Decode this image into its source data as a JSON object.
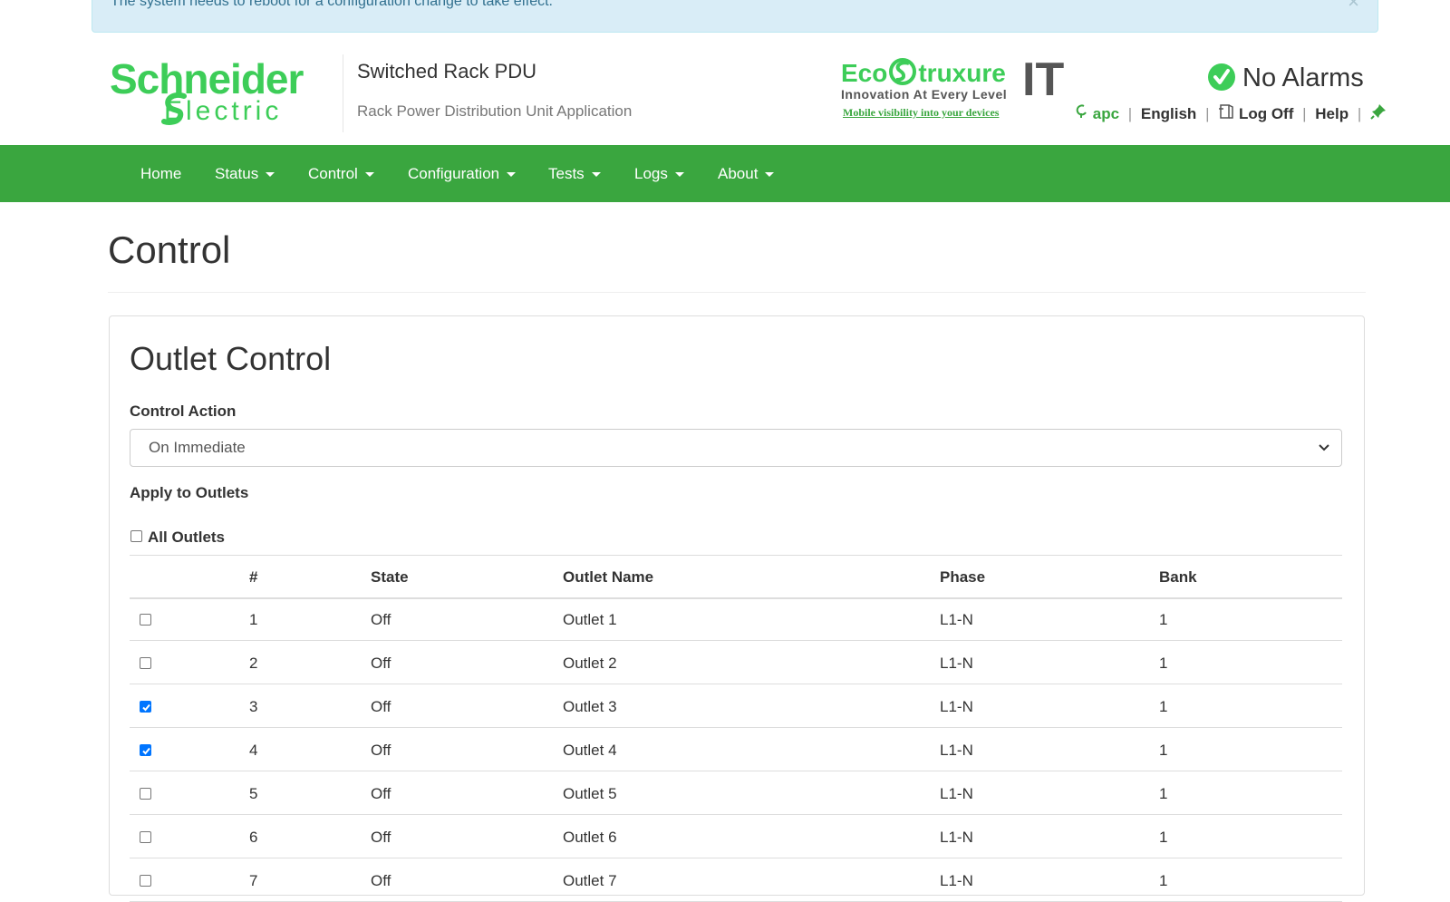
{
  "notice": {
    "message": "The system needs to reboot for a configuration change to take effect.",
    "close_label": "×"
  },
  "header": {
    "brand_line1": "Schneider",
    "brand_line2": "Electric",
    "app_title": "Switched Rack PDU",
    "app_subtitle": "Rack Power Distribution Unit Application",
    "eco_part1": "Eco",
    "eco_part2": "truxure",
    "eco_it": "IT",
    "eco_tagline": "Innovation At Every Level",
    "eco_link": "Mobile visibility into your devices",
    "alarm_status": "No Alarms",
    "user": "apc",
    "language": "English",
    "logoff": "Log Off",
    "help": "Help",
    "separator": "|"
  },
  "nav": {
    "items": [
      {
        "label": "Home"
      },
      {
        "label": "Status"
      },
      {
        "label": "Control"
      },
      {
        "label": "Configuration"
      },
      {
        "label": "Tests"
      },
      {
        "label": "Logs"
      },
      {
        "label": "About"
      }
    ]
  },
  "page": {
    "title": "Control",
    "panel_title": "Outlet Control",
    "control_action_label": "Control Action",
    "control_action_value": "On Immediate",
    "apply_label": "Apply to Outlets",
    "all_outlets_label": "All Outlets",
    "all_outlets_checked": false
  },
  "table": {
    "headers": [
      "#",
      "State",
      "Outlet Name",
      "Phase",
      "Bank"
    ],
    "rows": [
      {
        "checked": false,
        "num": "1",
        "state": "Off",
        "name": "Outlet 1",
        "phase": "L1-N",
        "bank": "1"
      },
      {
        "checked": false,
        "num": "2",
        "state": "Off",
        "name": "Outlet 2",
        "phase": "L1-N",
        "bank": "1"
      },
      {
        "checked": true,
        "num": "3",
        "state": "Off",
        "name": "Outlet 3",
        "phase": "L1-N",
        "bank": "1"
      },
      {
        "checked": true,
        "num": "4",
        "state": "Off",
        "name": "Outlet 4",
        "phase": "L1-N",
        "bank": "1"
      },
      {
        "checked": false,
        "num": "5",
        "state": "Off",
        "name": "Outlet 5",
        "phase": "L1-N",
        "bank": "1"
      },
      {
        "checked": false,
        "num": "6",
        "state": "Off",
        "name": "Outlet 6",
        "phase": "L1-N",
        "bank": "1"
      },
      {
        "checked": false,
        "num": "7",
        "state": "Off",
        "name": "Outlet 7",
        "phase": "L1-N",
        "bank": "1"
      }
    ]
  },
  "colors": {
    "brand_green": "#3dcd58",
    "nav_green": "#3aa63f",
    "checkbox_blue": "#0075ff",
    "notice_bg": "#d9edf7"
  }
}
